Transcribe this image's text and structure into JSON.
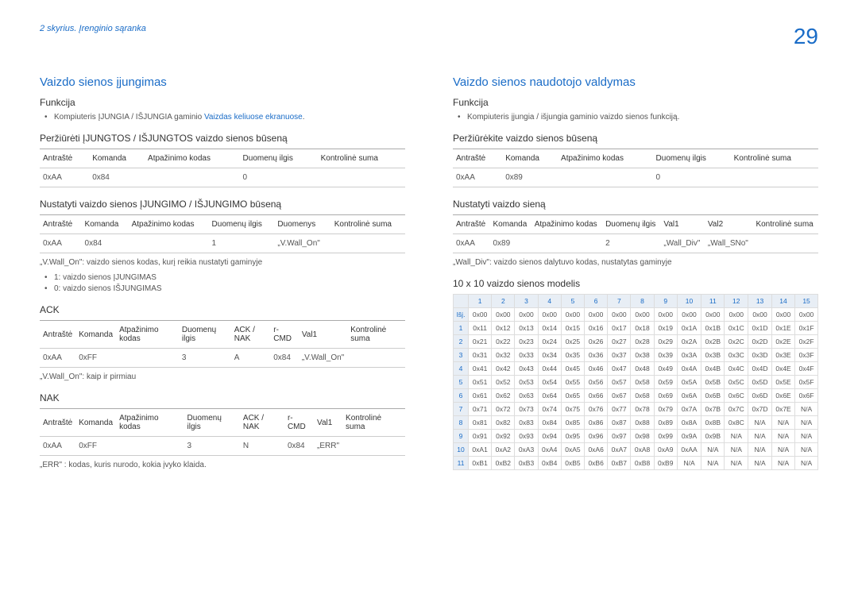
{
  "header": {
    "chapter": "2 skyrius. Įrenginio sąranka",
    "page": "29"
  },
  "left": {
    "title": "Vaizdo sienos įjungimas",
    "func_h": "Funkcija",
    "func_bullet_prefix": "Kompiuteris ĮJUNGIA / IŠJUNGIA gaminio ",
    "func_bullet_link": "Vaizdas keliuose ekranuose",
    "func_bullet_suffix": ".",
    "view_h": "Peržiūrėti ĮJUNGTOS / IŠJUNGTOS vaizdo sienos būseną",
    "t1": {
      "h": [
        "Antraštė",
        "Komanda",
        "Atpažinimo kodas",
        "Duomenų ilgis",
        "Kontrolinė suma"
      ],
      "r": [
        "0xAA",
        "0x84",
        "",
        "0",
        ""
      ]
    },
    "set_h": "Nustatyti vaizdo sienos ĮJUNGIMO / IŠJUNGIMO būseną",
    "t2": {
      "h": [
        "Antraštė",
        "Komanda",
        "Atpažinimo kodas",
        "Duomenų ilgis",
        "Duomenys",
        "Kontrolinė suma"
      ],
      "r": [
        "0xAA",
        "0x84",
        "",
        "1",
        "„V.Wall_On\"",
        ""
      ]
    },
    "note1": "„V.Wall_On\": vaizdo sienos kodas, kurį reikia nustatyti gaminyje",
    "bullets2": [
      "1: vaizdo sienos ĮJUNGIMAS",
      "0: vaizdo sienos IŠJUNGIMAS"
    ],
    "ack_h": "ACK",
    "t3": {
      "h": [
        "Antraštė",
        "Komanda",
        "Atpažinimo kodas",
        "Duomenų ilgis",
        "ACK / NAK",
        "r-CMD",
        "Val1",
        "Kontrolinė suma"
      ],
      "r": [
        "0xAA",
        "0xFF",
        "",
        "3",
        "A",
        "0x84",
        "„V.Wall_On\"",
        ""
      ]
    },
    "note2": "„V.Wall_On\": kaip ir pirmiau",
    "nak_h": "NAK",
    "t4": {
      "h": [
        "Antraštė",
        "Komanda",
        "Atpažinimo kodas",
        "Duomenų ilgis",
        "ACK / NAK",
        "r-CMD",
        "Val1",
        "Kontrolinė suma"
      ],
      "r": [
        "0xAA",
        "0xFF",
        "",
        "3",
        "N",
        "0x84",
        "„ERR\"",
        ""
      ]
    },
    "note3": "„ERR\" : kodas, kuris nurodo, kokia įvyko klaida."
  },
  "right": {
    "title": "Vaizdo sienos naudotojo valdymas",
    "func_h": "Funkcija",
    "func_bullet": "Kompiuteris įjungia / išjungia gaminio vaizdo sienos funkciją.",
    "view_h": "Peržiūrėkite vaizdo sienos būseną",
    "t1": {
      "h": [
        "Antraštė",
        "Komanda",
        "Atpažinimo kodas",
        "Duomenų ilgis",
        "Kontrolinė suma"
      ],
      "r": [
        "0xAA",
        "0x89",
        "",
        "0",
        ""
      ]
    },
    "set_h": "Nustatyti vaizdo sieną",
    "t2": {
      "h": [
        "Antraštė",
        "Komanda",
        "Atpažinimo kodas",
        "Duomenų ilgis",
        "Val1",
        "Val2",
        "Kontrolinė suma"
      ],
      "r": [
        "0xAA",
        "0x89",
        "",
        "2",
        "„Wall_Div\"",
        "„Wall_SNo\"",
        ""
      ]
    },
    "note1": "„Wall_Div\": vaizdo sienos dalytuvo kodas, nustatytas gaminyje",
    "model_h": "10 x 10 vaizdo sienos modelis",
    "matrix": {
      "cols": [
        "",
        "1",
        "2",
        "3",
        "4",
        "5",
        "6",
        "7",
        "8",
        "9",
        "10",
        "11",
        "12",
        "13",
        "14",
        "15"
      ],
      "rows": [
        [
          "Išj.",
          "0x00",
          "0x00",
          "0x00",
          "0x00",
          "0x00",
          "0x00",
          "0x00",
          "0x00",
          "0x00",
          "0x00",
          "0x00",
          "0x00",
          "0x00",
          "0x00",
          "0x00"
        ],
        [
          "1",
          "0x11",
          "0x12",
          "0x13",
          "0x14",
          "0x15",
          "0x16",
          "0x17",
          "0x18",
          "0x19",
          "0x1A",
          "0x1B",
          "0x1C",
          "0x1D",
          "0x1E",
          "0x1F"
        ],
        [
          "2",
          "0x21",
          "0x22",
          "0x23",
          "0x24",
          "0x25",
          "0x26",
          "0x27",
          "0x28",
          "0x29",
          "0x2A",
          "0x2B",
          "0x2C",
          "0x2D",
          "0x2E",
          "0x2F"
        ],
        [
          "3",
          "0x31",
          "0x32",
          "0x33",
          "0x34",
          "0x35",
          "0x36",
          "0x37",
          "0x38",
          "0x39",
          "0x3A",
          "0x3B",
          "0x3C",
          "0x3D",
          "0x3E",
          "0x3F"
        ],
        [
          "4",
          "0x41",
          "0x42",
          "0x43",
          "0x44",
          "0x45",
          "0x46",
          "0x47",
          "0x48",
          "0x49",
          "0x4A",
          "0x4B",
          "0x4C",
          "0x4D",
          "0x4E",
          "0x4F"
        ],
        [
          "5",
          "0x51",
          "0x52",
          "0x53",
          "0x54",
          "0x55",
          "0x56",
          "0x57",
          "0x58",
          "0x59",
          "0x5A",
          "0x5B",
          "0x5C",
          "0x5D",
          "0x5E",
          "0x5F"
        ],
        [
          "6",
          "0x61",
          "0x62",
          "0x63",
          "0x64",
          "0x65",
          "0x66",
          "0x67",
          "0x68",
          "0x69",
          "0x6A",
          "0x6B",
          "0x6C",
          "0x6D",
          "0x6E",
          "0x6F"
        ],
        [
          "7",
          "0x71",
          "0x72",
          "0x73",
          "0x74",
          "0x75",
          "0x76",
          "0x77",
          "0x78",
          "0x79",
          "0x7A",
          "0x7B",
          "0x7C",
          "0x7D",
          "0x7E",
          "N/A"
        ],
        [
          "8",
          "0x81",
          "0x82",
          "0x83",
          "0x84",
          "0x85",
          "0x86",
          "0x87",
          "0x88",
          "0x89",
          "0x8A",
          "0x8B",
          "0x8C",
          "N/A",
          "N/A",
          "N/A"
        ],
        [
          "9",
          "0x91",
          "0x92",
          "0x93",
          "0x94",
          "0x95",
          "0x96",
          "0x97",
          "0x98",
          "0x99",
          "0x9A",
          "0x9B",
          "N/A",
          "N/A",
          "N/A",
          "N/A"
        ],
        [
          "10",
          "0xA1",
          "0xA2",
          "0xA3",
          "0xA4",
          "0xA5",
          "0xA6",
          "0xA7",
          "0xA8",
          "0xA9",
          "0xAA",
          "N/A",
          "N/A",
          "N/A",
          "N/A",
          "N/A"
        ],
        [
          "11",
          "0xB1",
          "0xB2",
          "0xB3",
          "0xB4",
          "0xB5",
          "0xB6",
          "0xB7",
          "0xB8",
          "0xB9",
          "N/A",
          "N/A",
          "N/A",
          "N/A",
          "N/A",
          "N/A"
        ]
      ]
    }
  }
}
